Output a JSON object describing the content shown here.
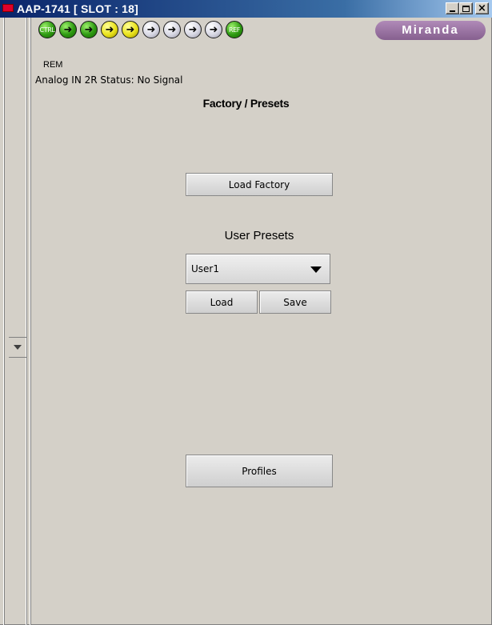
{
  "window": {
    "title": "AAP-1741 [ SLOT : 18]",
    "title_color": "#0a246a",
    "minimize_icon": "minimize-icon",
    "maximize_icon": "maximize-icon",
    "close_icon": "close-icon",
    "close_glyph": "×"
  },
  "status_leds": {
    "ctrl_label": "CTRL",
    "ref_label": "REF",
    "rem_label": "REM",
    "arrow_glyph": "➜",
    "items": [
      {
        "kind": "ctrl",
        "color": "green"
      },
      {
        "kind": "arrow",
        "color": "green"
      },
      {
        "kind": "arrow",
        "color": "green"
      },
      {
        "kind": "arrow",
        "color": "yellow"
      },
      {
        "kind": "arrow",
        "color": "yellow"
      },
      {
        "kind": "arrow",
        "color": "gray"
      },
      {
        "kind": "arrow",
        "color": "gray"
      },
      {
        "kind": "arrow",
        "color": "gray"
      },
      {
        "kind": "arrow",
        "color": "gray"
      },
      {
        "kind": "ref",
        "color": "green"
      }
    ]
  },
  "brand": {
    "logo_text": "Miranda",
    "logo_color": "#9a73a3"
  },
  "status": {
    "text": "Analog IN 2R Status: No Signal"
  },
  "panel": {
    "title": "Factory / Presets",
    "load_factory_label": "Load Factory",
    "user_presets_label": "User Presets",
    "preset_select": {
      "selected": "User1"
    },
    "load_label": "Load",
    "save_label": "Save",
    "profiles_label": "Profiles"
  },
  "side_rail": {
    "toggle_icon": "chevron-down-icon"
  }
}
